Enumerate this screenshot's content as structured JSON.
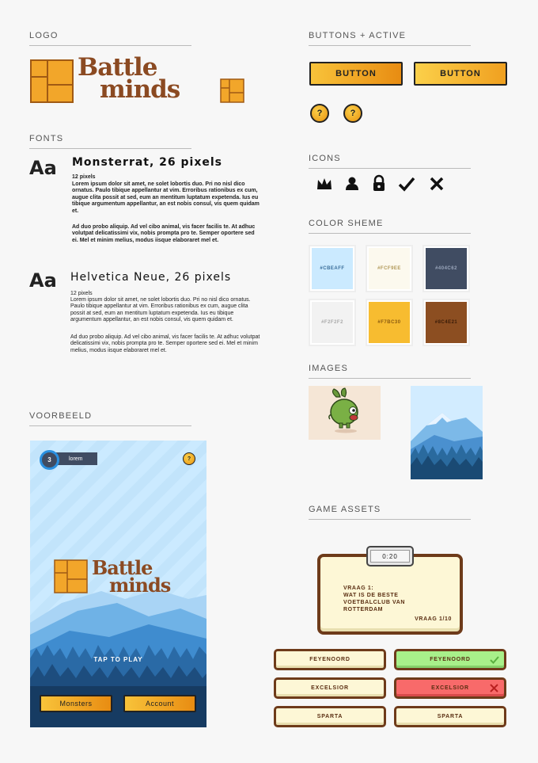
{
  "sections": {
    "logo": "LOGO",
    "buttons": "BUTTONS + ACTIVE",
    "fonts": "FONTS",
    "icons": "ICONS",
    "color_scheme": "COLOR SHEME",
    "images": "IMAGES",
    "voorbeeld": "VOORBEELD",
    "game_assets": "GAME ASSETS"
  },
  "logo": {
    "line1": "Battle",
    "line2": "minds"
  },
  "fonts": {
    "aa": "Aa",
    "f1": {
      "title": "Monsterrat, 26 pixels",
      "size": "12 pixels",
      "p1": "Lorem ipsum dolor sit amet, ne solet lobortis duo. Pri no nisl dico ornatus. Paulo tibique appellantur at vim. Erroribus rationibus ex cum, augue clita possit at sed, eum an mentitum luptatum expetenda. Ius eu tibique argumentum appellantur, an est nobis consul, vis quem quidam et.",
      "p2": "Ad duo probo aliquip. Ad vel cibo animal, vis facer facilis te. At adhuc volutpat delicatissimi vix, nobis prompta pro te. Semper oportere sed ei. Mel et minim melius, modus iisque elaboraret mel et."
    },
    "f2": {
      "title": "Helvetica Neue, 26 pixels",
      "size": "12 pixels",
      "p1": "Lorem ipsum dolor sit amet, ne solet lobortis duo. Pri no nisl dico ornatus. Paulo tibique appellantur at vim. Erroribus rationibus ex cum, augue clita possit at sed, eum an mentitum luptatum expetenda. Ius eu tibique argumentum appellantur, an est nobis consul, vis quem quidam et.",
      "p2": "Ad duo probo aliquip. Ad vel cibo animal, vis facer facilis te. At adhuc volutpat delicatissimi vix, nobis prompta pro te. Semper oportere sed ei. Mel et minim melius, modus iisque elaboraret mel et."
    }
  },
  "buttons": {
    "label": "BUTTON",
    "label_active": "BUTTON",
    "help": "?"
  },
  "icons": [
    "crown-icon",
    "user-icon",
    "lock-icon",
    "check-icon",
    "close-icon"
  ],
  "colors": [
    {
      "hex": "#CBEAFF",
      "label": "#CBEAFF",
      "text": "#3a6e9a"
    },
    {
      "hex": "#FCF9EE",
      "label": "#FCF9EE",
      "text": "#b29a5a"
    },
    {
      "hex": "#404C62",
      "label": "#404C62",
      "text": "#9aa6bc"
    },
    {
      "hex": "#F2F2F2",
      "label": "#F2F2F2",
      "text": "#aaaaaa"
    },
    {
      "hex": "#F7BC30",
      "label": "#F7BC30",
      "text": "#8a5a10"
    },
    {
      "hex": "#8C4E21",
      "label": "#8C4E21",
      "text": "#3a1c08"
    }
  ],
  "preview": {
    "level": "3",
    "username": "lorem",
    "help": "?",
    "tap": "TAP TO PLAY",
    "monsters": "Monsters",
    "account": "Account"
  },
  "assets": {
    "timer": "0:20",
    "question_label": "VRAAG 1:",
    "question": "WAT IS DE BESTE VOETBALCLUB VAN ROTTERDAM",
    "counter": "VRAAG 1/10",
    "answers_left": [
      "FEYENOORD",
      "EXCELSIOR",
      "SPARTA"
    ],
    "answers_right": [
      "FEYENOORD",
      "EXCELSIOR",
      "SPARTA"
    ],
    "correct_color": "#a8f08a",
    "wrong_color": "#f86a6a"
  }
}
